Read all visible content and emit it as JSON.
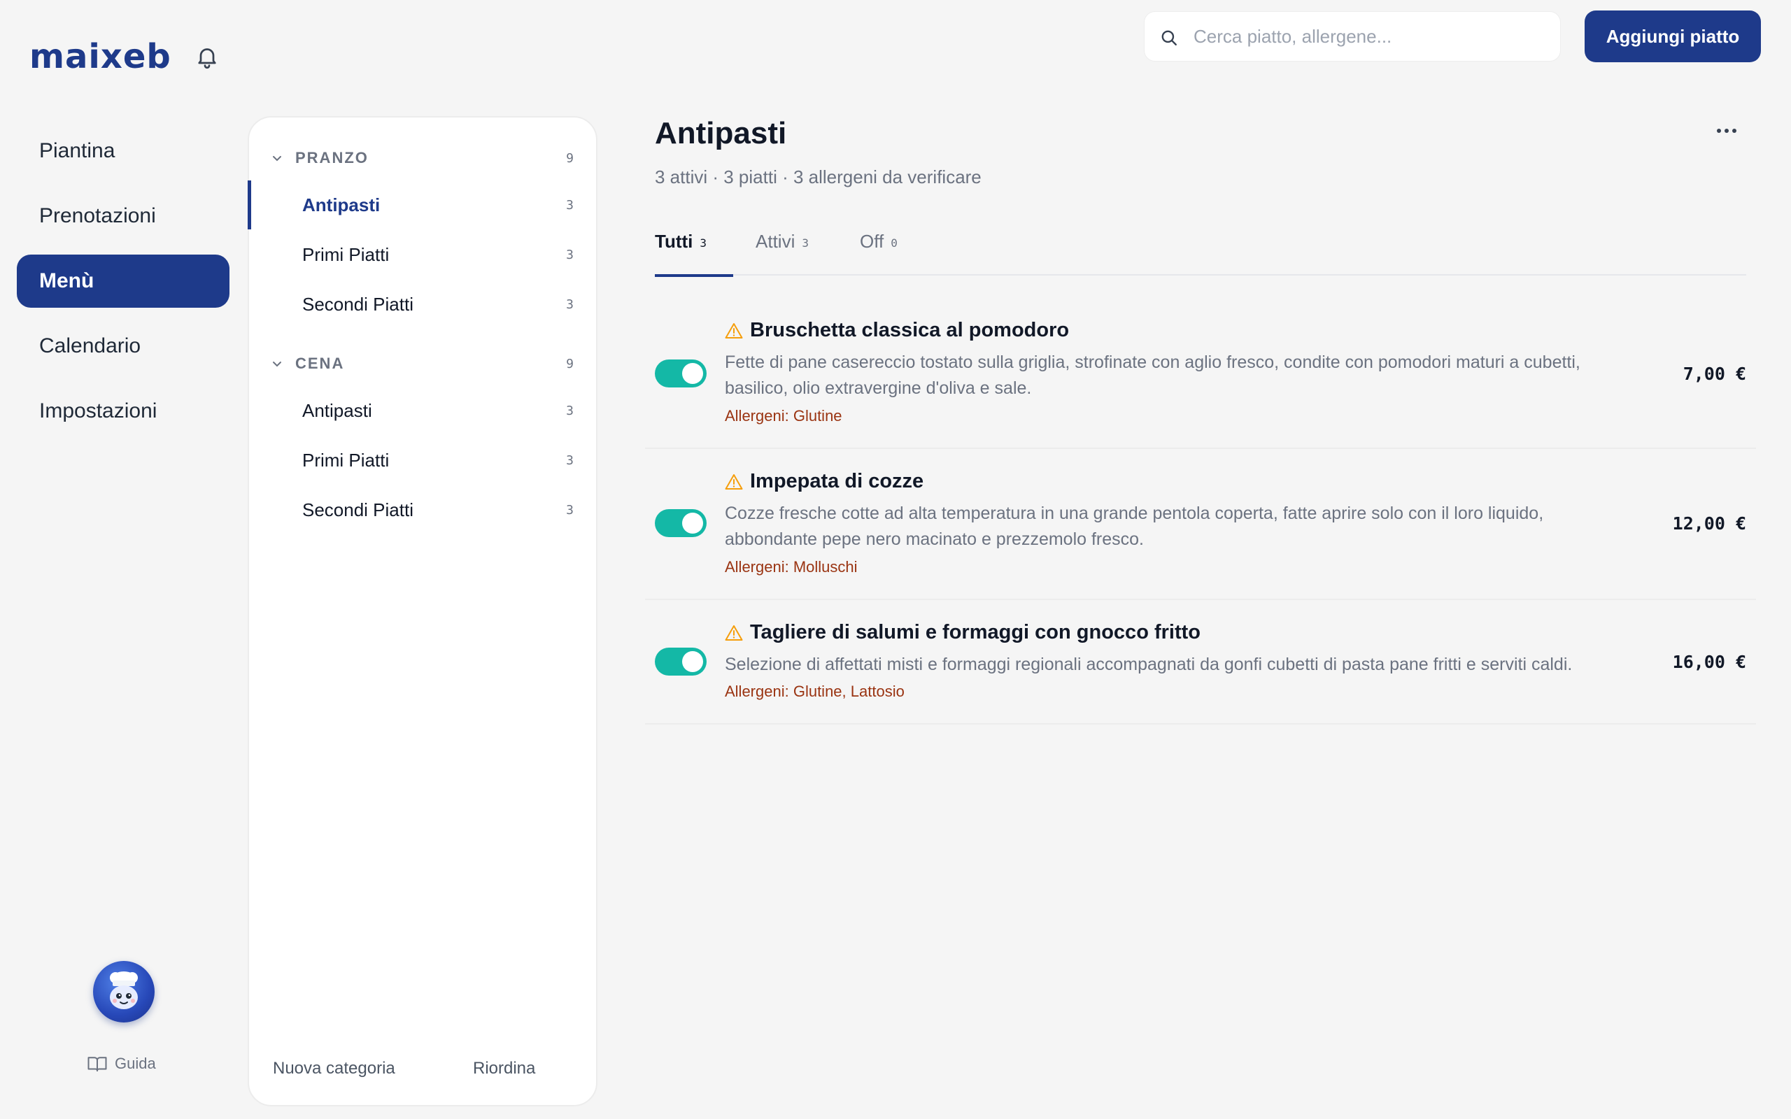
{
  "app": {
    "logo": "maixeb"
  },
  "nav": {
    "items": [
      {
        "label": "Piantina"
      },
      {
        "label": "Prenotazioni"
      },
      {
        "label": "Menù"
      },
      {
        "label": "Calendario"
      },
      {
        "label": "Impostazioni"
      }
    ],
    "active": "Menù",
    "guide_label": "Guida"
  },
  "categories": {
    "groups": [
      {
        "name": "PRANZO",
        "count": "9",
        "items": [
          {
            "name": "Antipasti",
            "count": "3"
          },
          {
            "name": "Primi Piatti",
            "count": "3"
          },
          {
            "name": "Secondi Piatti",
            "count": "3"
          }
        ]
      },
      {
        "name": "CENA",
        "count": "9",
        "items": [
          {
            "name": "Antipasti",
            "count": "3"
          },
          {
            "name": "Primi Piatti",
            "count": "3"
          },
          {
            "name": "Secondi Piatti",
            "count": "3"
          }
        ]
      }
    ],
    "footer": {
      "new_category": "Nuova categoria",
      "reorder": "Riordina"
    }
  },
  "search": {
    "placeholder": "Cerca piatto, allergene...",
    "value": ""
  },
  "toolbar": {
    "add_dish": "Aggiungi piatto"
  },
  "main": {
    "title": "Antipasti",
    "subtitle": "3 attivi · 3 piatti · 3 allergeni da verificare",
    "tabs": [
      {
        "label": "Tutti",
        "count": "3"
      },
      {
        "label": "Attivi",
        "count": "3"
      },
      {
        "label": "Off",
        "count": "0"
      }
    ],
    "dishes": [
      {
        "name": "Bruschetta classica al pomodoro",
        "description": "Fette di pane casereccio tostato sulla griglia, strofinate con aglio fresco, condite con pomodori maturi a cubetti, basilico, olio extravergine d'oliva e sale.",
        "allergens": "Allergeni: Glutine",
        "price": "7,00 €",
        "active": true
      },
      {
        "name": "Impepata di cozze",
        "description": "Cozze fresche cotte ad alta temperatura in una grande pentola coperta, fatte aprire solo con il loro liquido, abbondante pepe nero macinato e prezzemolo fresco.",
        "allergens": "Allergeni: Molluschi",
        "price": "12,00 €",
        "active": true
      },
      {
        "name": "Tagliere di salumi e formaggi con gnocco fritto",
        "description": "Selezione di affettati misti e formaggi regionali accompagnati da gonfi cubetti di pasta pane fritti e serviti caldi.",
        "allergens": "Allergeni: Glutine, Lattosio",
        "price": "16,00 €",
        "active": true
      }
    ]
  },
  "colors": {
    "brand": "#1e3a8a",
    "toggle_on": "#14b8a6",
    "warning": "#f59e0b",
    "allergen_text": "#9a3412"
  }
}
